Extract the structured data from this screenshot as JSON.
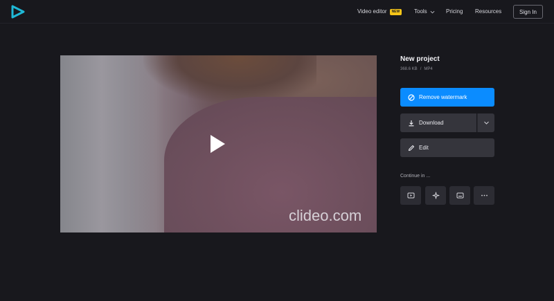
{
  "header": {
    "nav": {
      "video_editor": "Video editor",
      "new_badge": "NEW",
      "tools": "Tools",
      "pricing": "Pricing",
      "resources": "Resources"
    },
    "sign_in": "Sign In"
  },
  "video": {
    "watermark": "clideo.com"
  },
  "project": {
    "title": "New project",
    "size": "368.6 KB",
    "separator": "/",
    "format": "MP4"
  },
  "actions": {
    "remove_watermark": "Remove watermark",
    "download": "Download",
    "edit": "Edit"
  },
  "continue_in": {
    "label": "Continue in ...",
    "tools": [
      "video-player-icon",
      "sparkle-icon",
      "subtitles-icon",
      "more-icon"
    ]
  },
  "colors": {
    "background": "#18181d",
    "accent": "#0b8cff",
    "badge": "#f5c518",
    "logo": "#1fb8d6"
  }
}
